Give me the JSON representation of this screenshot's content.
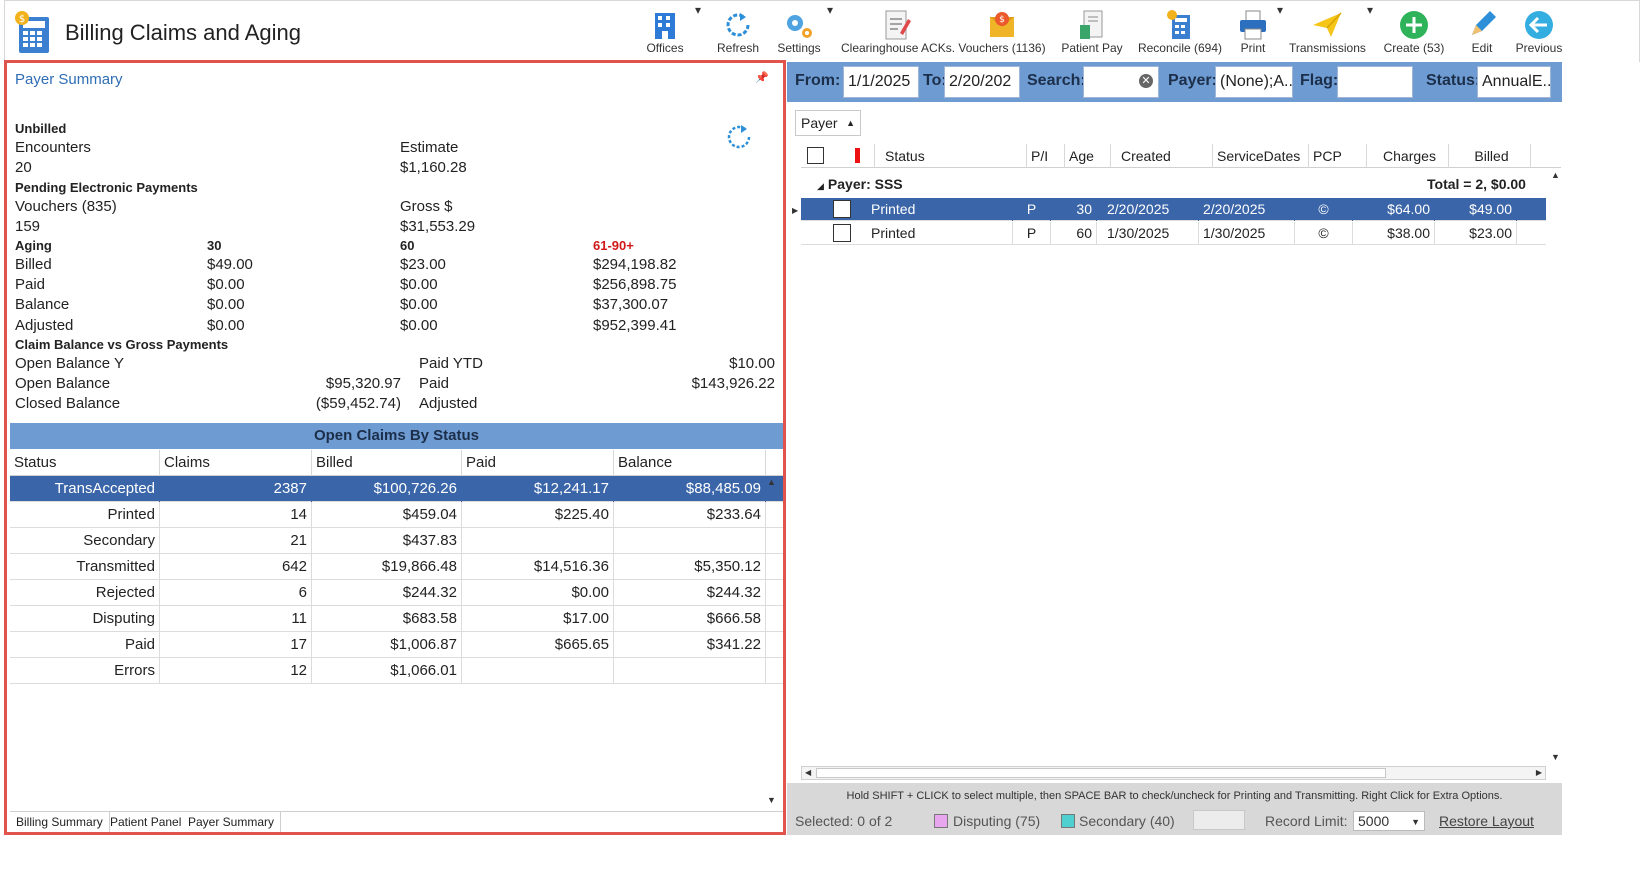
{
  "app": {
    "title": "Billing Claims and Aging"
  },
  "toolbar": [
    {
      "label": "Offices",
      "icon": "offices-icon"
    },
    {
      "label": "Refresh",
      "icon": "refresh-icon"
    },
    {
      "label": "Settings",
      "icon": "settings-icon"
    },
    {
      "label": "Clearinghouse ACKs.",
      "icon": "clearinghouse-icon"
    },
    {
      "label": "Vouchers (1136)",
      "icon": "vouchers-icon"
    },
    {
      "label": "Patient Pay",
      "icon": "patient-pay-icon"
    },
    {
      "label": "Reconcile (694)",
      "icon": "reconcile-icon"
    },
    {
      "label": "Print",
      "icon": "print-icon"
    },
    {
      "label": "Transmissions",
      "icon": "transmissions-icon"
    },
    {
      "label": "Create (53)",
      "icon": "create-icon"
    },
    {
      "label": "Edit",
      "icon": "edit-icon"
    },
    {
      "label": "Previous",
      "icon": "previous-icon"
    }
  ],
  "payer_summary": {
    "title": "Payer Summary",
    "unbilled": {
      "heading": "Unbilled",
      "col1_label": "Encounters",
      "col1_value": "20",
      "col2_label": "Estimate",
      "col2_value": "$1,160.28"
    },
    "pending": {
      "heading": "Pending Electronic Payments",
      "col1_label": "Vouchers (835)",
      "col1_value": "159",
      "col2_label": "Gross $",
      "col2_value": "$31,553.29"
    },
    "aging": {
      "heading": "Aging",
      "h30": "30",
      "h60": "60",
      "h61": "61-90+",
      "rows": [
        {
          "label": "Billed",
          "v30": "$49.00",
          "v60": "$23.00",
          "v61": "$294,198.82"
        },
        {
          "label": "Paid",
          "v30": "$0.00",
          "v60": "$0.00",
          "v61": "$256,898.75"
        },
        {
          "label": "Balance",
          "v30": "$0.00",
          "v60": "$0.00",
          "v61": "$37,300.07"
        },
        {
          "label": "Adjusted",
          "v30": "$0.00",
          "v60": "$0.00",
          "v61": "$952,399.41"
        }
      ]
    },
    "claim_balance": {
      "heading": "Claim Balance vs Gross Payments",
      "rows": [
        {
          "left_label": "Open Balance Y",
          "left_value": "",
          "right_label": "Paid YTD",
          "right_value": "$10.00"
        },
        {
          "left_label": "Open Balance",
          "left_value": "$95,320.97",
          "right_label": "Paid",
          "right_value": "$143,926.22"
        },
        {
          "left_label": "Closed Balance",
          "left_value": "($59,452.74)",
          "right_label": "Adjusted",
          "right_value": ""
        }
      ]
    },
    "open_claims": {
      "title": "Open Claims By Status",
      "columns": [
        "Status",
        "Claims",
        "Billed",
        "Paid",
        "Balance"
      ],
      "rows": [
        {
          "status": "TransAccepted",
          "claims": "2387",
          "billed": "$100,726.26",
          "paid": "$12,241.17",
          "balance": "$88,485.09"
        },
        {
          "status": "Printed",
          "claims": "14",
          "billed": "$459.04",
          "paid": "$225.40",
          "balance": "$233.64"
        },
        {
          "status": "Secondary",
          "claims": "21",
          "billed": "$437.83",
          "paid": "",
          "balance": ""
        },
        {
          "status": "Transmitted",
          "claims": "642",
          "billed": "$19,866.48",
          "paid": "$14,516.36",
          "balance": "$5,350.12"
        },
        {
          "status": "Rejected",
          "claims": "6",
          "billed": "$244.32",
          "paid": "$0.00",
          "balance": "$244.32"
        },
        {
          "status": "Disputing",
          "claims": "11",
          "billed": "$683.58",
          "paid": "$17.00",
          "balance": "$666.58"
        },
        {
          "status": "Paid",
          "claims": "17",
          "billed": "$1,006.87",
          "paid": "$665.65",
          "balance": "$341.22"
        },
        {
          "status": "Errors",
          "claims": "12",
          "billed": "$1,066.01",
          "paid": "",
          "balance": ""
        }
      ]
    },
    "tabs": [
      "Billing Summary",
      "Patient Panel",
      "Payer Summary"
    ]
  },
  "filters": {
    "from_label": "From:",
    "from_value": "1/1/2025",
    "to_label": "To:",
    "to_value": "2/20/202",
    "search_label": "Search:",
    "search_value": "",
    "payer_label": "Payer:",
    "payer_value": "(None);A...",
    "flag_label": "Flag:",
    "flag_value": "",
    "status_label": "Status:",
    "status_value": "AnnualE..."
  },
  "claims_grid": {
    "group_by": "Payer",
    "columns": [
      "Status",
      "P/I",
      "Age",
      "Created",
      "ServiceDates",
      "PCP",
      "Charges",
      "Billed"
    ],
    "group_label": "Payer: SSS",
    "group_total": "Total = 2,  $0.00",
    "rows": [
      {
        "status": "Printed",
        "pi": "P",
        "age": "30",
        "created": "2/20/2025",
        "service": "2/20/2025",
        "pcp": "©",
        "charges": "$64.00",
        "billed": "$49.00"
      },
      {
        "status": "Printed",
        "pi": "P",
        "age": "60",
        "created": "1/30/2025",
        "service": "1/30/2025",
        "pcp": "©",
        "charges": "$38.00",
        "billed": "$23.00"
      }
    ]
  },
  "status_bar": {
    "hint": "Hold SHIFT + CLICK to select multiple, then SPACE BAR to check/uncheck for Printing and Transmitting. Right Click for Extra Options.",
    "selected": "Selected: 0 of 2",
    "disputing": "Disputing (75)",
    "secondary": "Secondary (40)",
    "record_limit_label": "Record Limit:",
    "record_limit_value": "5000",
    "restore_layout": "Restore Layout"
  },
  "colors": {
    "accent": "#6f9bd3",
    "selected_row": "#3a65a8",
    "panel_border": "#e0544d",
    "aging_red": "#d01818",
    "disputing_swatch": "#e8a6ef",
    "secondary_swatch": "#4fd0d0"
  }
}
